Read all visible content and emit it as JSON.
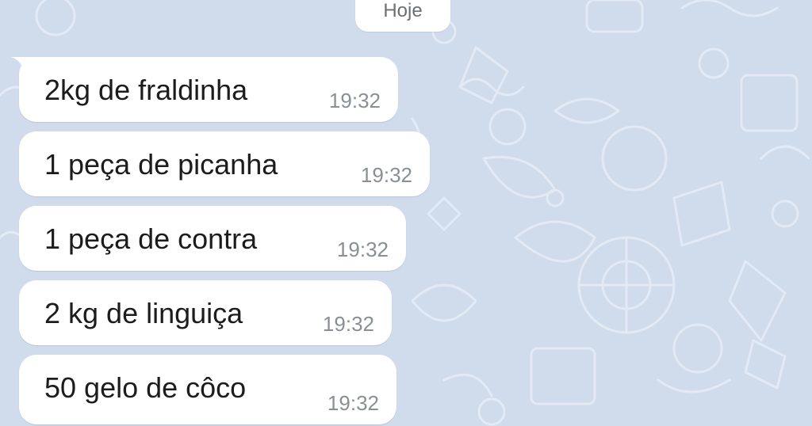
{
  "chat": {
    "date_label": "Hoje",
    "messages": [
      {
        "text": "2kg de fraldinha",
        "time": "19:32"
      },
      {
        "text": "1 peça de picanha",
        "time": "19:32"
      },
      {
        "text": "1 peça de contra",
        "time": "19:32"
      },
      {
        "text": "2 kg de linguiça",
        "time": "19:32"
      },
      {
        "text": "50 gelo de côco",
        "time": "19:32"
      }
    ]
  },
  "colors": {
    "wallpaper": "#d0dbec",
    "bubble": "#ffffff",
    "message_text": "#1c1c1c",
    "timestamp": "#8a8f95"
  },
  "icons": [
    "doodle-wallpaper-pattern"
  ]
}
